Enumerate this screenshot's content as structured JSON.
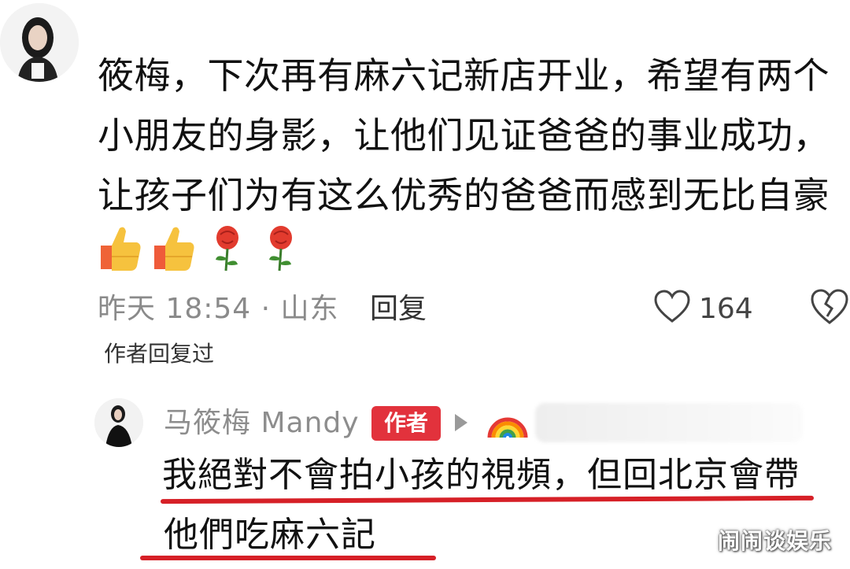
{
  "comment": {
    "lines": [
      "筱梅，下次再有麻六记新店开业，希望有两个",
      "小朋友的身影，让他们见证爸爸的事业成功，",
      "让孩子们为有这么优秀的爸爸而感到无比自豪"
    ],
    "emojis": [
      "thumbs-up-icon",
      "thumbs-up-icon",
      "rose-icon",
      "rose-icon"
    ],
    "meta": "昨天 18:54 · 山东",
    "reply_label": "回复",
    "likes": "164",
    "author_replied_label": "作者回复过"
  },
  "reply": {
    "author_name": "马筱梅 Mandy",
    "author_badge": "作者",
    "lines": [
      "我絕對不會拍小孩的視頻，但回北京會帶",
      "他們吃麻六記"
    ],
    "highlight_color": "#d62027"
  },
  "watermark": "闹闹谈娱乐",
  "colors": {
    "badge": "#e2323c",
    "meta_gray": "#8a8a8a"
  }
}
